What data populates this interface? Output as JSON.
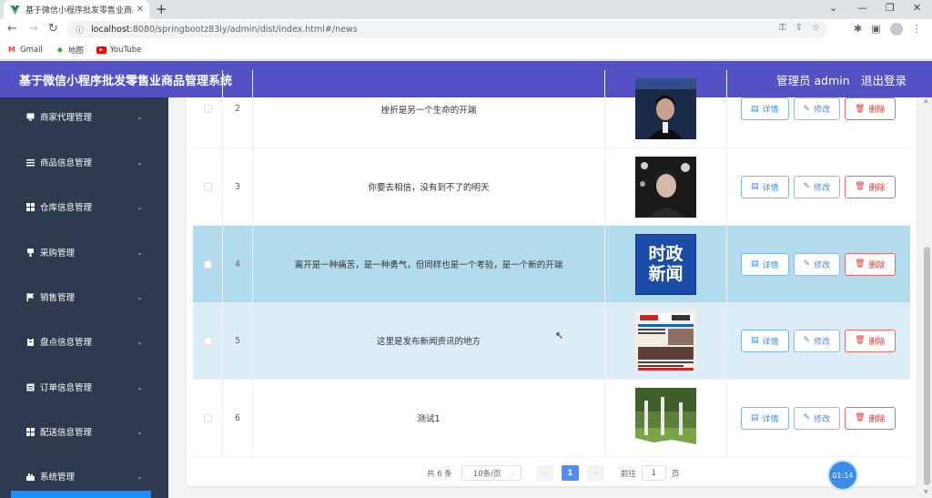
{
  "browser": {
    "tab_title": "基于微信小程序批发零售业商品管",
    "url_host": "localhost",
    "url_rest": ":8080/springbootz83iy/admin/dist/index.html#/news",
    "bookmarks": [
      "Gmail",
      "地图",
      "YouTube"
    ]
  },
  "header": {
    "title": "基于微信小程序批发零售业商品管理系统",
    "admin": "管理员 admin",
    "logout": "退出登录"
  },
  "sidebar": {
    "items": [
      {
        "label": "商家代理管理",
        "icon": "monitor-icon"
      },
      {
        "label": "商品信息管理",
        "icon": "list-icon"
      },
      {
        "label": "仓库信息管理",
        "icon": "grid-icon"
      },
      {
        "label": "采购管理",
        "icon": "pin-icon"
      },
      {
        "label": "销售管理",
        "icon": "flag-icon"
      },
      {
        "label": "盘点信息管理",
        "icon": "clipboard-icon"
      },
      {
        "label": "订单信息管理",
        "icon": "document-icon"
      },
      {
        "label": "配送信息管理",
        "icon": "grid-icon"
      },
      {
        "label": "系统管理",
        "icon": "settings-icon"
      }
    ]
  },
  "table": {
    "rows": [
      {
        "index": "2",
        "title": "挫折是另一个生命的开端",
        "image": "portrait-photo"
      },
      {
        "index": "3",
        "title": "你要去相信，没有到不了的明天",
        "image": "portrait-photo-dark"
      },
      {
        "index": "4",
        "title": "离开是一种痛苦，是一种勇气，但同样也是一个考验，是一个新的开端",
        "image": "news-badge",
        "image_text": [
          "时政",
          "新闻"
        ]
      },
      {
        "index": "5",
        "title": "这里是发布新闻资讯的地方",
        "image": "newspaper"
      },
      {
        "index": "6",
        "title": "测试1",
        "image": "trees-photo"
      }
    ],
    "actions": {
      "detail": "详情",
      "edit": "修改",
      "delete": "删除"
    }
  },
  "pagination": {
    "total": "共 6 条",
    "page_size": "10条/页",
    "current_page": "1",
    "goto_label": "前往",
    "goto_value": "1",
    "page_suffix": "页"
  },
  "timer": "01:14",
  "colors": {
    "header": "#5451c4",
    "sidebar": "#2e3a4f",
    "row_active": "#b3dbee",
    "row_hover": "#dcedf7",
    "primary": "#4f8df5",
    "danger": "#d83636"
  }
}
